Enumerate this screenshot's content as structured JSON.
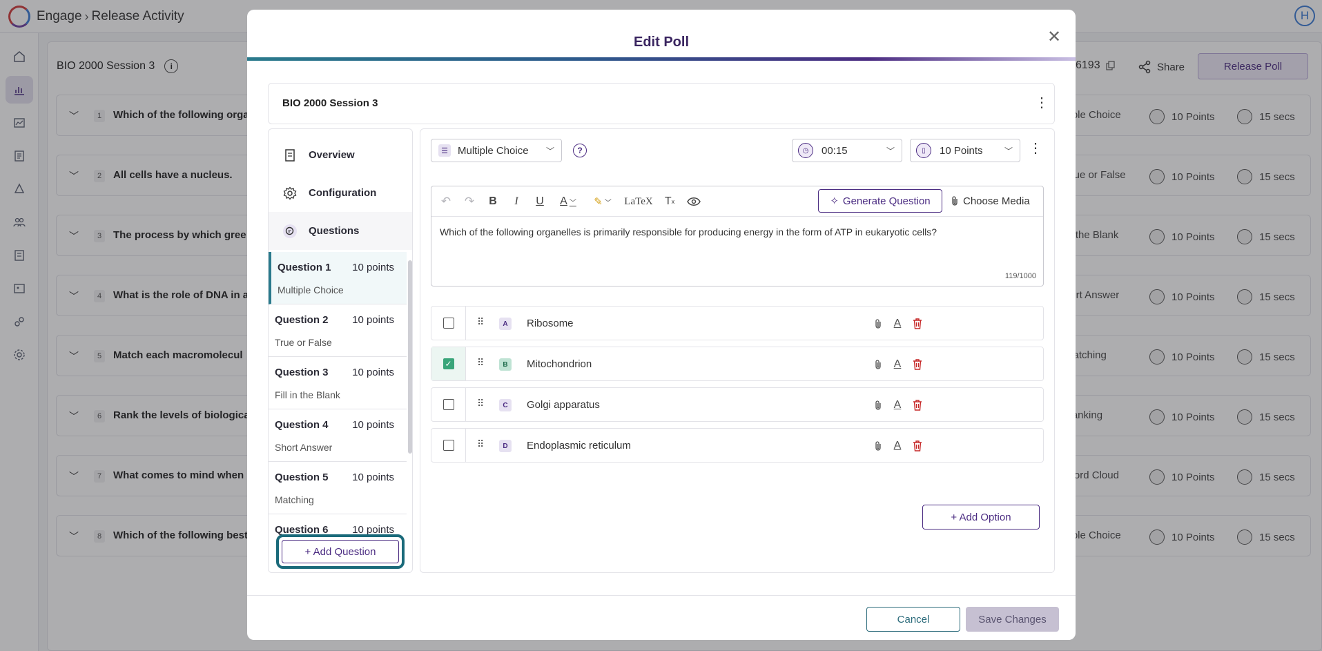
{
  "app": {
    "breadcrumb_root": "Engage",
    "breadcrumb_page": "Release Activity",
    "user_initial": "H"
  },
  "background": {
    "session_title": "BIO 2000 Session 3",
    "code_suffix": "6193",
    "share_label": "Share",
    "release_label": "Release Poll",
    "rows": [
      {
        "num": "1",
        "text": "Which of the following orga",
        "type": "ltiple Choice",
        "points": "10 Points",
        "secs": "15 secs"
      },
      {
        "num": "2",
        "text": "All cells have a nucleus.",
        "type": "True or False",
        "points": "10 Points",
        "secs": "15 secs"
      },
      {
        "num": "3",
        "text": "The process by which gree",
        "type": "in the Blank",
        "points": "10 Points",
        "secs": "15 secs"
      },
      {
        "num": "4",
        "text": "What is the role of DNA in a",
        "type": "hort Answer",
        "points": "10 Points",
        "secs": "15 secs"
      },
      {
        "num": "5",
        "text": "Match each macromolecul",
        "type": "Matching",
        "points": "10 Points",
        "secs": "15 secs"
      },
      {
        "num": "6",
        "text": "Rank the levels of biologica",
        "type": "Ranking",
        "points": "10 Points",
        "secs": "15 secs"
      },
      {
        "num": "7",
        "text": "What comes to mind when",
        "type": "Word Cloud",
        "points": "10 Points",
        "secs": "15 secs"
      },
      {
        "num": "8",
        "text": "Which of the following best",
        "type": "ltiple Choice",
        "points": "10 Points",
        "secs": "15 secs"
      }
    ]
  },
  "modal": {
    "title": "Edit Poll",
    "poll_name": "BIO 2000 Session 3",
    "nav": {
      "overview": "Overview",
      "configuration": "Configuration",
      "questions": "Questions"
    },
    "questions": [
      {
        "name": "Question 1",
        "points": "10 points",
        "type": "Multiple Choice"
      },
      {
        "name": "Question 2",
        "points": "10 points",
        "type": "True or False"
      },
      {
        "name": "Question 3",
        "points": "10 points",
        "type": "Fill in the Blank"
      },
      {
        "name": "Question 4",
        "points": "10 points",
        "type": "Short Answer"
      },
      {
        "name": "Question 5",
        "points": "10 points",
        "type": "Matching"
      },
      {
        "name": "Question 6",
        "points": "10 points",
        "type": ""
      }
    ],
    "add_question": "+ Add Question",
    "question_type": "Multiple Choice",
    "timer": "00:15",
    "points": "10 Points",
    "generate_question": "Generate Question",
    "choose_media": "Choose Media",
    "latex": "LaTeX",
    "question_text": "Which of the following organelles is primarily responsible for producing energy in the form of ATP in eukaryotic cells?",
    "char_count": "119/1000",
    "options": [
      {
        "letter": "A",
        "text": "Ribosome",
        "correct": false
      },
      {
        "letter": "B",
        "text": "Mitochondrion",
        "correct": true
      },
      {
        "letter": "C",
        "text": "Golgi apparatus",
        "correct": false
      },
      {
        "letter": "D",
        "text": "Endoplasmic reticulum",
        "correct": false
      }
    ],
    "add_option": "+ Add Option",
    "cancel": "Cancel",
    "save": "Save Changes"
  },
  "colors": {
    "brand": "#4b2c82",
    "teal": "#2a7a8c",
    "correct": "#3aa57a",
    "delete": "#c62828"
  }
}
